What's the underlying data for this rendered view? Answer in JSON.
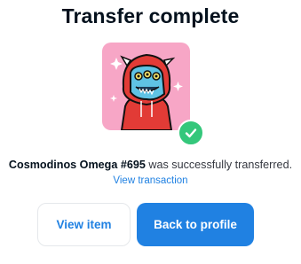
{
  "header": {
    "title": "Transfer complete"
  },
  "nft": {
    "image_icon": "cosmodino-nft-image",
    "badge_icon": "checkmark-icon",
    "colors": {
      "background": "#f7a6c6",
      "hood": "#e23b36",
      "face": "#5fc3e4",
      "badge": "#34c77b"
    }
  },
  "message": {
    "item_name": "Cosmodinos Omega #695",
    "suffix": " was successfully transferred.",
    "link": "View transaction"
  },
  "actions": {
    "view_item": "View item",
    "back_to_profile": "Back to profile"
  },
  "colors": {
    "accent": "#2081e2",
    "text": "#04111d"
  }
}
